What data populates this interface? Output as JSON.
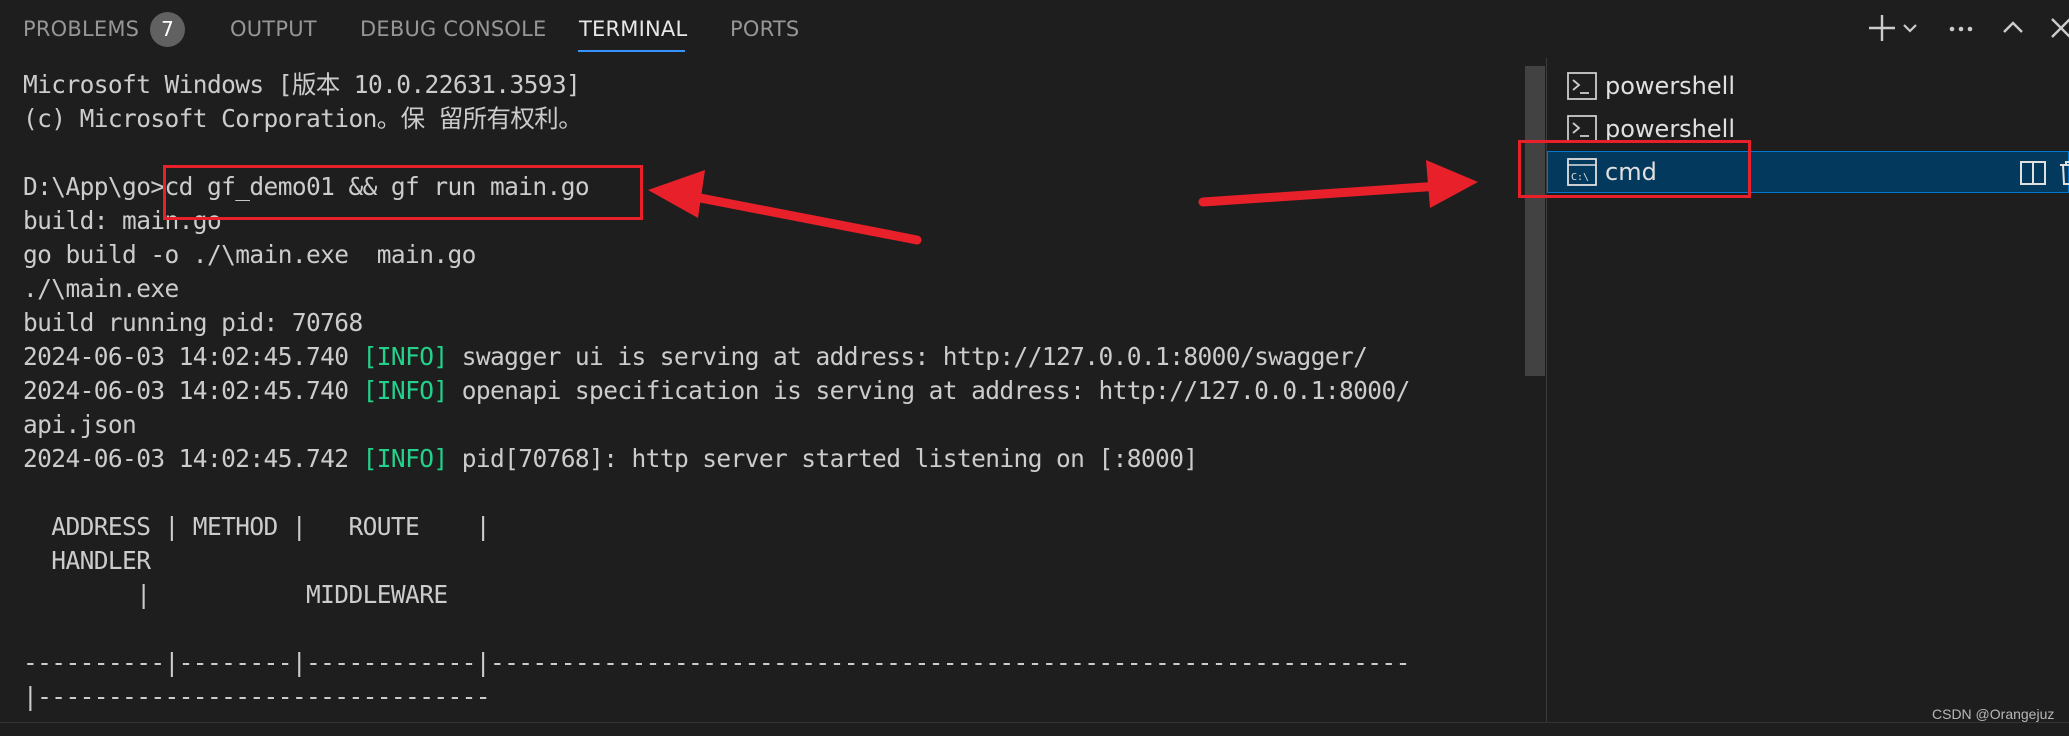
{
  "panel": {
    "tabs": [
      {
        "label": "PROBLEMS",
        "badge": "7"
      },
      {
        "label": "OUTPUT"
      },
      {
        "label": "DEBUG CONSOLE"
      },
      {
        "label": "TERMINAL",
        "active": true
      },
      {
        "label": "PORTS"
      }
    ],
    "toolbar_icons": [
      "plus-icon",
      "chevron-down-icon",
      "ellipsis-icon",
      "chevron-up-icon",
      "close-icon"
    ]
  },
  "terminal": {
    "lines": [
      "Microsoft Windows [版本 10.0.22631.3593]",
      "(c) Microsoft Corporation。保 留所有权利。",
      "",
      "D:\\App\\go>cd gf_demo01 && gf run main.go",
      "build: main.go",
      "go build -o ./\\main.exe  main.go",
      "./\\main.exe",
      "build running pid: 70768"
    ],
    "log_lines": [
      {
        "time": "2024-06-03 14:02:45.740",
        "level": "[INFO]",
        "message": "swagger ui is serving at address: http://127.0.0.1:8000/swagger/"
      },
      {
        "time": "2024-06-03 14:02:45.740",
        "level": "[INFO]",
        "message": "openapi specification is serving at address: http://127.0.0.1:8000/",
        "wrap": "api.json"
      },
      {
        "time": "2024-06-03 14:02:45.742",
        "level": "[INFO]",
        "message": "pid[70768]: http server started listening on [:8000]"
      }
    ],
    "table_lines": [
      "",
      "  ADDRESS | METHOD |   ROUTE    |",
      "  HANDLER",
      "        |           MIDDLEWARE",
      "",
      "----------|--------|------------|-----------------------------------------------------------------",
      "|--------------------------------"
    ]
  },
  "terminal_list": {
    "items": [
      {
        "label": "powershell",
        "icon": "terminal-prompt-icon"
      },
      {
        "label": "powershell",
        "icon": "terminal-prompt-icon"
      },
      {
        "label": "cmd",
        "icon": "cmd-icon",
        "selected": true
      }
    ]
  },
  "colors": {
    "background": "#1e1e1e",
    "info": "#23d18b",
    "selection": "#04395e",
    "annotation_red": "#e8202a",
    "active_tab_underline": "#3794ff"
  },
  "watermark": "CSDN @Orangejuz"
}
